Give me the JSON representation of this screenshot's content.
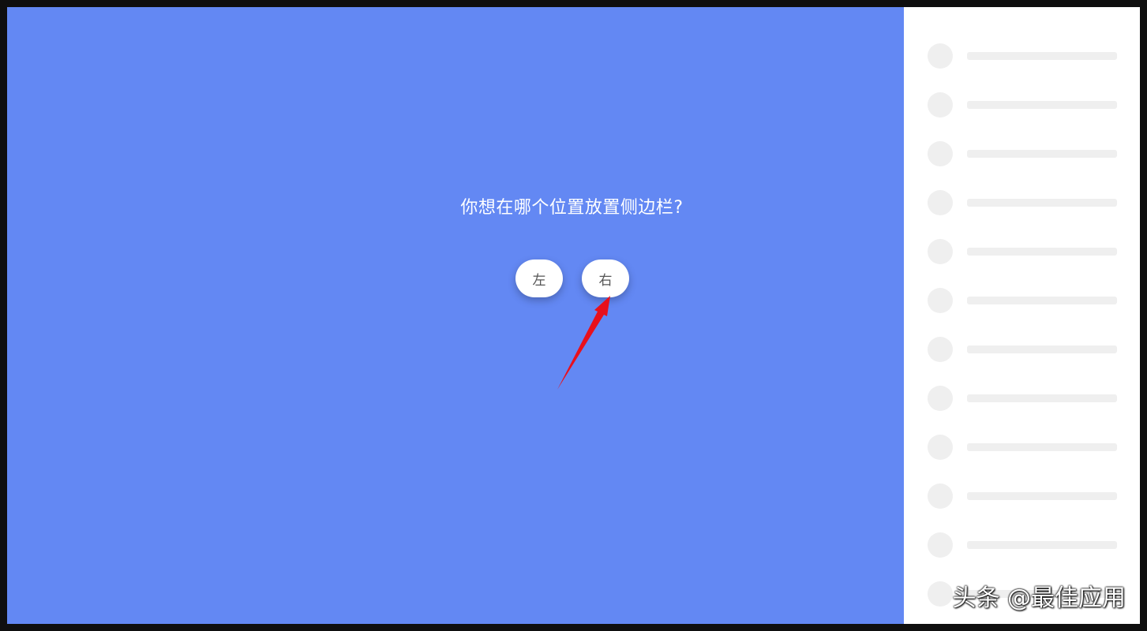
{
  "prompt": {
    "question": "你想在哪个位置放置侧边栏?"
  },
  "options": {
    "left_label": "左",
    "right_label": "右"
  },
  "colors": {
    "background_accent": "#6388f3",
    "sidebar_background": "#ffffff",
    "skeleton": "#efefef",
    "annotation_arrow": "#e8101c"
  },
  "sidebar": {
    "placeholder_rows": 12
  },
  "watermark": {
    "text": "头条 @最佳应用"
  }
}
